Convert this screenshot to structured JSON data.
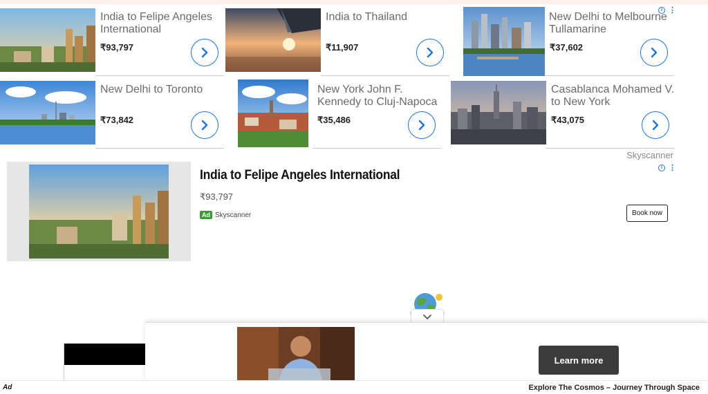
{
  "cards": [
    {
      "route": "India to Felipe Angeles International",
      "price": "₹93,797",
      "image": "city-sunset-photo"
    },
    {
      "route": "India to Thailand",
      "price": "₹11,907",
      "image": "airplane-wing-photo"
    },
    {
      "route": "New Delhi to Melbourne Tullamarine",
      "price": "₹37,602",
      "image": "melbourne-skyline-photo"
    },
    {
      "route": "New Delhi to Toronto",
      "price": "₹73,842",
      "image": "toronto-skyline-photo"
    },
    {
      "route": "New York John F. Kennedy to Cluj-Napoca",
      "price": "₹35,486",
      "image": "cluj-napoca-photo"
    },
    {
      "route": "Casablanca Mohamed V. to New York",
      "price": "₹43,075",
      "image": "new-york-skyline-photo"
    }
  ],
  "brand": "Skyscanner",
  "adchoice": {
    "info_glyph": "i",
    "menu_glyph": "⋮"
  },
  "big_ad": {
    "title": "India to Felipe Angeles International",
    "price": "₹93,797",
    "badge": "Ad",
    "advertiser": "Skyscanner",
    "button": "Book now"
  },
  "sticky_ad": {
    "button": "Learn more",
    "collapse_icon": "chevron-down-icon"
  },
  "footer": {
    "ad_label": "Ad",
    "title": "Explore The Cosmos – Journey Through Space"
  },
  "colors": {
    "accent": "#1a73e8",
    "ad_badge": "#3d9b35",
    "learn_button": "#3c3c3c"
  }
}
